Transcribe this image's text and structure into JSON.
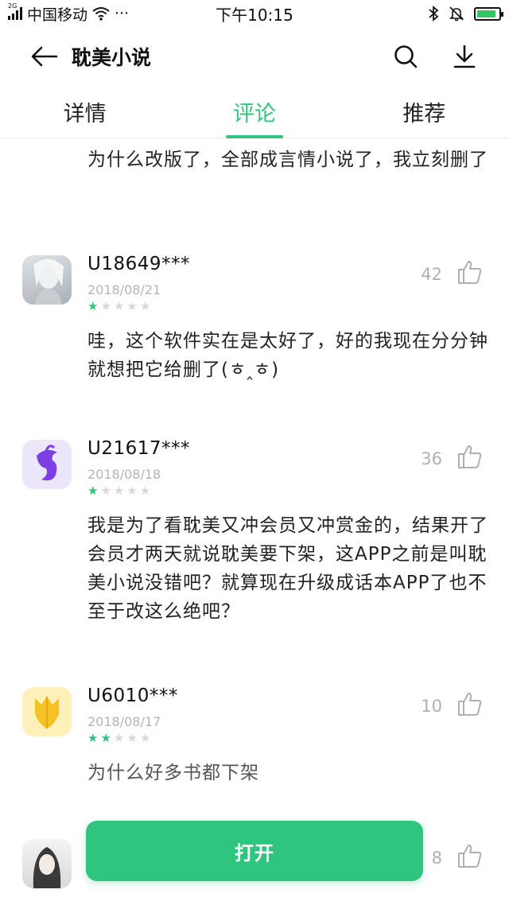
{
  "status_bar": {
    "network_type": "2G",
    "carrier": "中国移动",
    "time": "下午10:15",
    "more_dots": "···",
    "battery_level": 0.9
  },
  "app_bar": {
    "title": "耽美小说"
  },
  "tabs": [
    {
      "label": "详情",
      "active": false
    },
    {
      "label": "评论",
      "active": true
    },
    {
      "label": "推荐",
      "active": false
    }
  ],
  "partial_review": {
    "text": "为什么改版了，全部成言情小说了，我立刻删了"
  },
  "reviews": [
    {
      "username": "U18649***",
      "date": "2018/08/21",
      "rating": 1,
      "likes": "42",
      "text": "哇，这个软件实在是太好了，好的我现在分分钟就想把它给删了(ㅎ‸ㅎ)"
    },
    {
      "username": "U21617***",
      "date": "2018/08/18",
      "rating": 1,
      "likes": "36",
      "text": "我是为了看耽美又冲会员又冲赏金的，结果开了会员才两天就说耽美要下架，这APP之前是叫耽美小说没错吧？就算现在升级成话本APP了也不至于改这么绝吧？"
    },
    {
      "username": "U6010***",
      "date": "2018/08/17",
      "rating": 2,
      "likes": "10",
      "text": "为什么好多书都下架"
    },
    {
      "username": "",
      "date": "",
      "rating": 0,
      "likes": "8",
      "text": ""
    }
  ],
  "open_button": {
    "label": "打开"
  },
  "colors": {
    "accent": "#2fc57e",
    "star_off": "#d8d8d8",
    "muted": "#b0b0b0"
  }
}
